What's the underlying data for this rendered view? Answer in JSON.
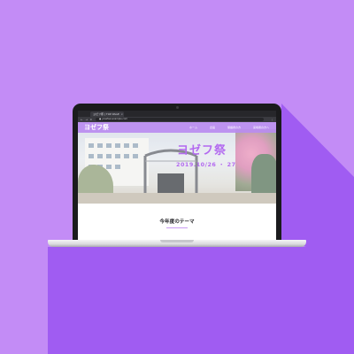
{
  "browser": {
    "tab_title": "ヨゼフ祭 | TOP PAGE",
    "tab_close": "×",
    "nav_icons": "← → C",
    "url": "● yosefsai.example.com",
    "menu": "⋮"
  },
  "site": {
    "logo": "ヨゼフ祭",
    "nav": [
      "ホーム",
      "企画",
      "保護者の方",
      "来場者の方へ"
    ]
  },
  "hero": {
    "title": "ヨゼフ祭",
    "date": "2019.10/26 ・ 27"
  },
  "section": {
    "title": "今年度のテーマ"
  },
  "colors": {
    "background": "#c38cf6",
    "shadow": "#a05cf2",
    "accent": "#b36af0",
    "laptop_lid": "#1b1b1d"
  }
}
